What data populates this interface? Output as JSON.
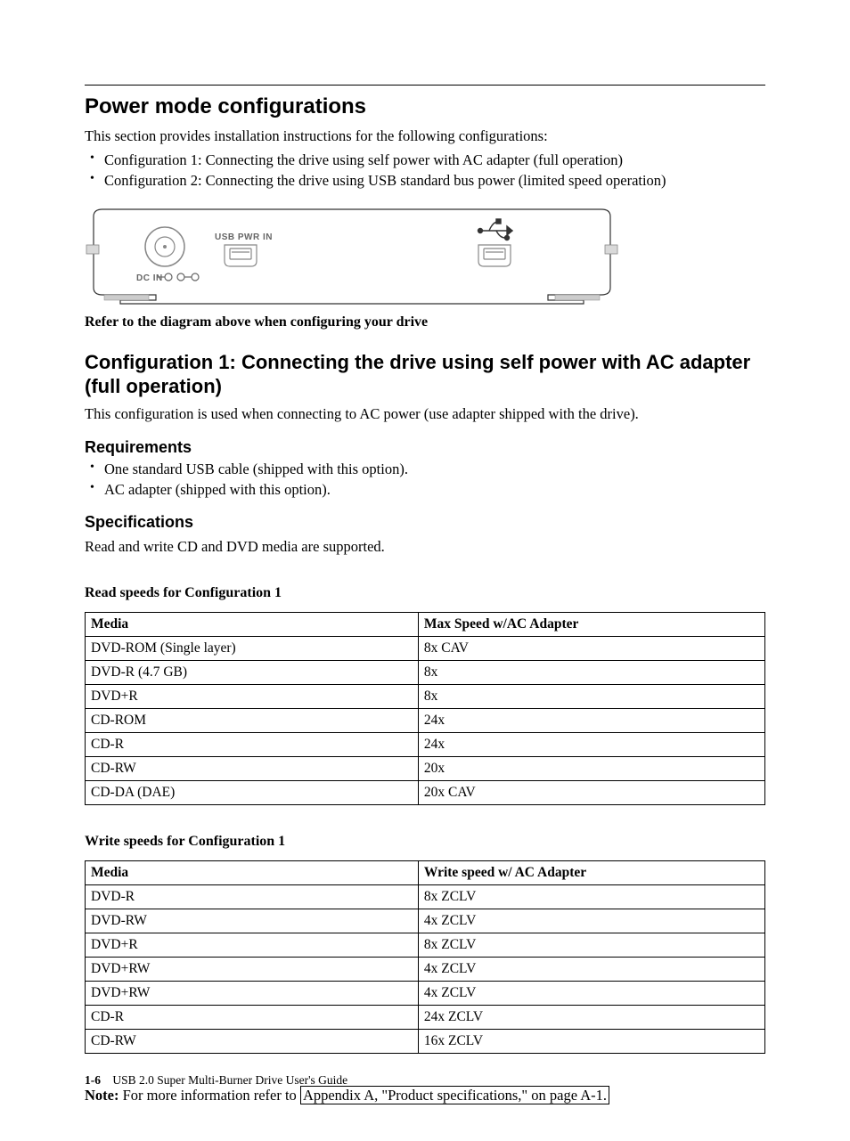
{
  "h1": "Power mode configurations",
  "intro": "This section provides installation instructions for the following configurations:",
  "intro_items": [
    "Configuration 1: Connecting the drive using self power with AC adapter (full operation)",
    "Configuration 2: Connecting the drive using USB standard bus power (limited speed operation)"
  ],
  "diagram": {
    "usb_pwr_in_label": "USB PWR IN",
    "dc_in_label": "DC IN",
    "caption": "Refer to the diagram above when configuring your drive"
  },
  "config1": {
    "title": "Configuration 1: Connecting the drive using self power with AC adapter (full operation)",
    "intro": "This configuration is used when connecting to AC power (use adapter shipped with the drive).",
    "requirements_heading": "Requirements",
    "requirements": [
      "One standard USB cable (shipped with this option).",
      "AC adapter (shipped with this option)."
    ],
    "specs_heading": "Specifications",
    "specs_text": "Read and write CD and DVD media are supported."
  },
  "read_table": {
    "title": "Read speeds for Configuration 1",
    "headers": [
      "Media",
      "Max Speed w/AC Adapter"
    ],
    "rows": [
      [
        "DVD-ROM (Single layer)",
        "8x CAV"
      ],
      [
        "DVD-R (4.7 GB)",
        "8x"
      ],
      [
        "DVD+R",
        "8x"
      ],
      [
        "CD-ROM",
        "24x"
      ],
      [
        "CD-R",
        "24x"
      ],
      [
        "CD-RW",
        "20x"
      ],
      [
        "CD-DA (DAE)",
        "20x CAV"
      ]
    ]
  },
  "write_table": {
    "title": "Write speeds for Configuration 1",
    "headers": [
      "Media",
      "Write speed w/ AC Adapter"
    ],
    "rows": [
      [
        "DVD-R",
        "8x ZCLV"
      ],
      [
        "DVD-RW",
        "4x ZCLV"
      ],
      [
        "DVD+R",
        "8x ZCLV"
      ],
      [
        "DVD+RW",
        "4x ZCLV"
      ],
      [
        "DVD+RW",
        "4x ZCLV"
      ],
      [
        "CD-R",
        "24x ZCLV"
      ],
      [
        "CD-RW",
        "16x ZCLV"
      ]
    ]
  },
  "note": {
    "lead": "Note:",
    "text_before_link": " For more information refer to ",
    "link_text": "Appendix A, \"Product specifications,\" on page A-1."
  },
  "footer": {
    "page": "1-6",
    "book": "USB 2.0 Super Multi-Burner Drive User's Guide"
  }
}
